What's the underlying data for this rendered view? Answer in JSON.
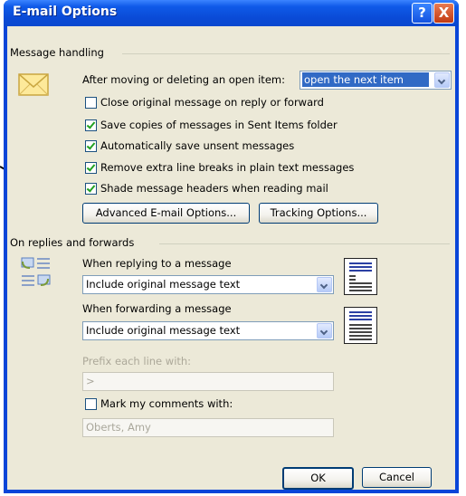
{
  "title": "E-mail Options",
  "title_buttons": {
    "help": "?",
    "close": "X"
  },
  "message_handling": {
    "header": "Message handling",
    "after_moving_label": "After moving or deleting an open item:",
    "after_moving_value": "open the next item",
    "checkboxes": [
      {
        "label": "Close original message on reply or forward",
        "checked": false
      },
      {
        "label": "Save copies of messages in Sent Items folder",
        "checked": true
      },
      {
        "label": "Automatically save unsent messages",
        "checked": true
      },
      {
        "label": "Remove extra line breaks in plain text messages",
        "checked": true
      },
      {
        "label": "Shade message headers when reading mail",
        "checked": true
      }
    ],
    "advanced_button": "Advanced E-mail Options...",
    "tracking_button": "Tracking Options..."
  },
  "replies": {
    "header": "On replies and forwards",
    "replying_label": "When replying to a message",
    "replying_value": "Include original message text",
    "forwarding_label": "When forwarding a message",
    "forwarding_value": "Include original message text",
    "prefix_label": "Prefix each line with:",
    "prefix_value": ">",
    "mark_label": "Mark my comments with:",
    "mark_checked": false,
    "mark_value": "Oberts, Amy"
  },
  "footer": {
    "ok": "OK",
    "cancel": "Cancel"
  },
  "colors": {
    "title_bar": "#0a4ad6",
    "selection": "#316ac5",
    "face": "#ece9d8"
  }
}
